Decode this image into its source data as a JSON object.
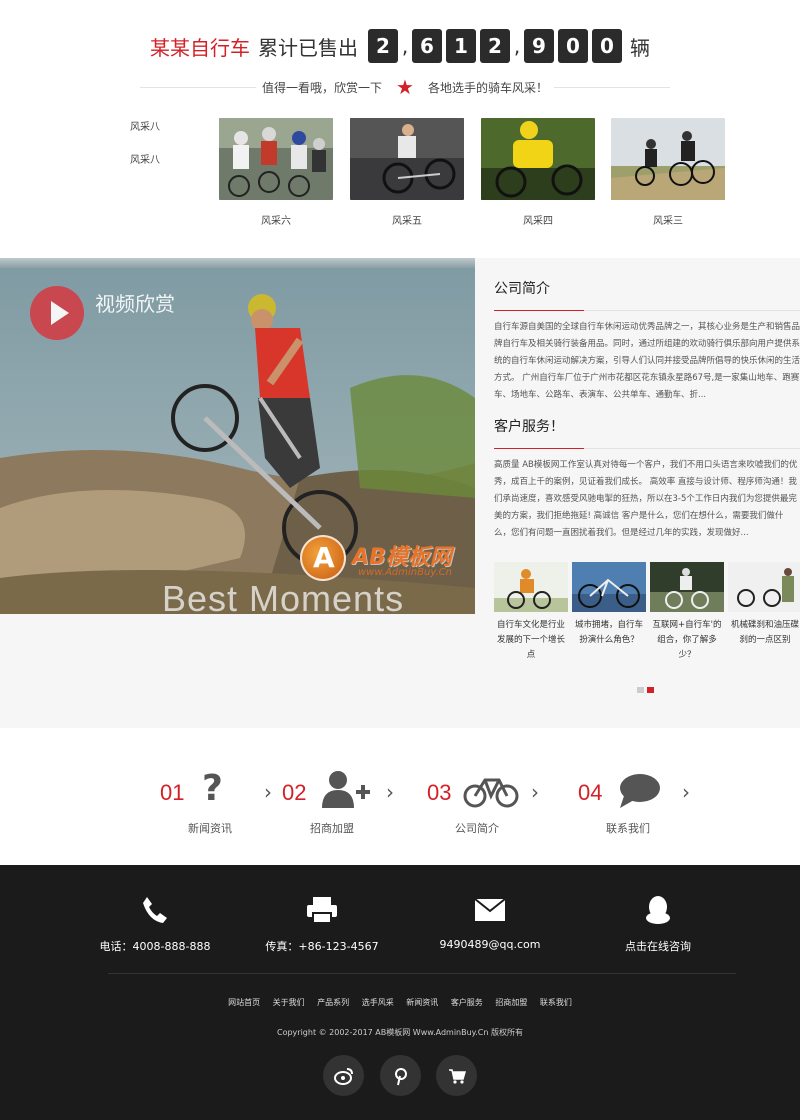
{
  "counter": {
    "brand": "某某自行车",
    "text": "累计已售出",
    "digits": [
      "2",
      "6",
      "1",
      "2",
      "9",
      "0",
      "0"
    ],
    "separator": ",",
    "unit": "辆"
  },
  "tagline": {
    "left": "值得一看哦，欣赏一下",
    "right": "各地选手的骑车风采！"
  },
  "gallery": {
    "broken_alt": "风采八",
    "broken_caption": "风采八",
    "items": [
      {
        "label": "风采六"
      },
      {
        "label": "风采五"
      },
      {
        "label": "风采四"
      },
      {
        "label": "风采三"
      }
    ]
  },
  "video": {
    "title": "视频欣赏",
    "overlay_text": "Best Moments",
    "watermark_title": "AB模板网",
    "watermark_url": "www.AdminBuy.Cn"
  },
  "about": {
    "title": "公司简介",
    "text": "自行车源自美国的全球自行车休闲运动优秀品牌之一，其核心业务是生产和销售品牌自行车及相关骑行装备用品。同时，通过所组建的欢动骑行俱乐部向用户提供系统的自行车休闲运动解决方案，引导人们认同并接受品牌所倡导的快乐休闲的生活方式。 广州自行车厂位于广州市花都区花东镇永星路67号,是一家集山地车、跑赛车、场地车、公路车、表演车、公共单车、通勤车、折..."
  },
  "service": {
    "title": "客户服务！",
    "text": "高质量 AB模板网工作室认真对待每一个客户，我们不用口头语言来吹嘘我们的优秀，成百上千的案例，见证着我们成长。 高效率 直接与设计师、程序师沟通！我们承尚速度，喜欢感受风驰电掣的狂热，所以在3-5个工作日内我们为您提供最完美的方案，我们拒绝拖延! 高诚信 客户是什么，您们在想什么，需要我们做什么，您们有问题一直困扰着我们。但是经过几年的实践，发现做好..."
  },
  "news": [
    {
      "title": "自行车文化是行业发展的下一个增长点"
    },
    {
      "title": "城市拥堵，自行车扮演什么角色？"
    },
    {
      "title": "互联网+自行车'的组合，你了解多少？"
    },
    {
      "title": "机械碟刹和油压碟刹的一点区别"
    }
  ],
  "features": [
    {
      "num": "01",
      "label": "新闻资讯",
      "icon": "question-icon"
    },
    {
      "num": "02",
      "label": "招商加盟",
      "icon": "add-user-icon"
    },
    {
      "num": "03",
      "label": "公司简介",
      "icon": "bicycle-icon"
    },
    {
      "num": "04",
      "label": "联系我们",
      "icon": "chat-bubble-icon"
    }
  ],
  "footer": {
    "phone": "电话：4008-888-888",
    "fax": "传真：+86-123-4567",
    "email": "9490489@qq.com",
    "online": "点击在线咨询",
    "links": [
      "网站首页",
      "关于我们",
      "产品系列",
      "选手风采",
      "新闻资讯",
      "客户服务",
      "招商加盟",
      "联系我们"
    ],
    "copyright": "Copyright © 2002-2017 AB模板网 Www.AdminBuy.Cn 版权所有"
  },
  "colors": {
    "accent": "#d32128",
    "footer_bg": "#1c1b1b",
    "digit_bg": "#2b2b2b"
  }
}
